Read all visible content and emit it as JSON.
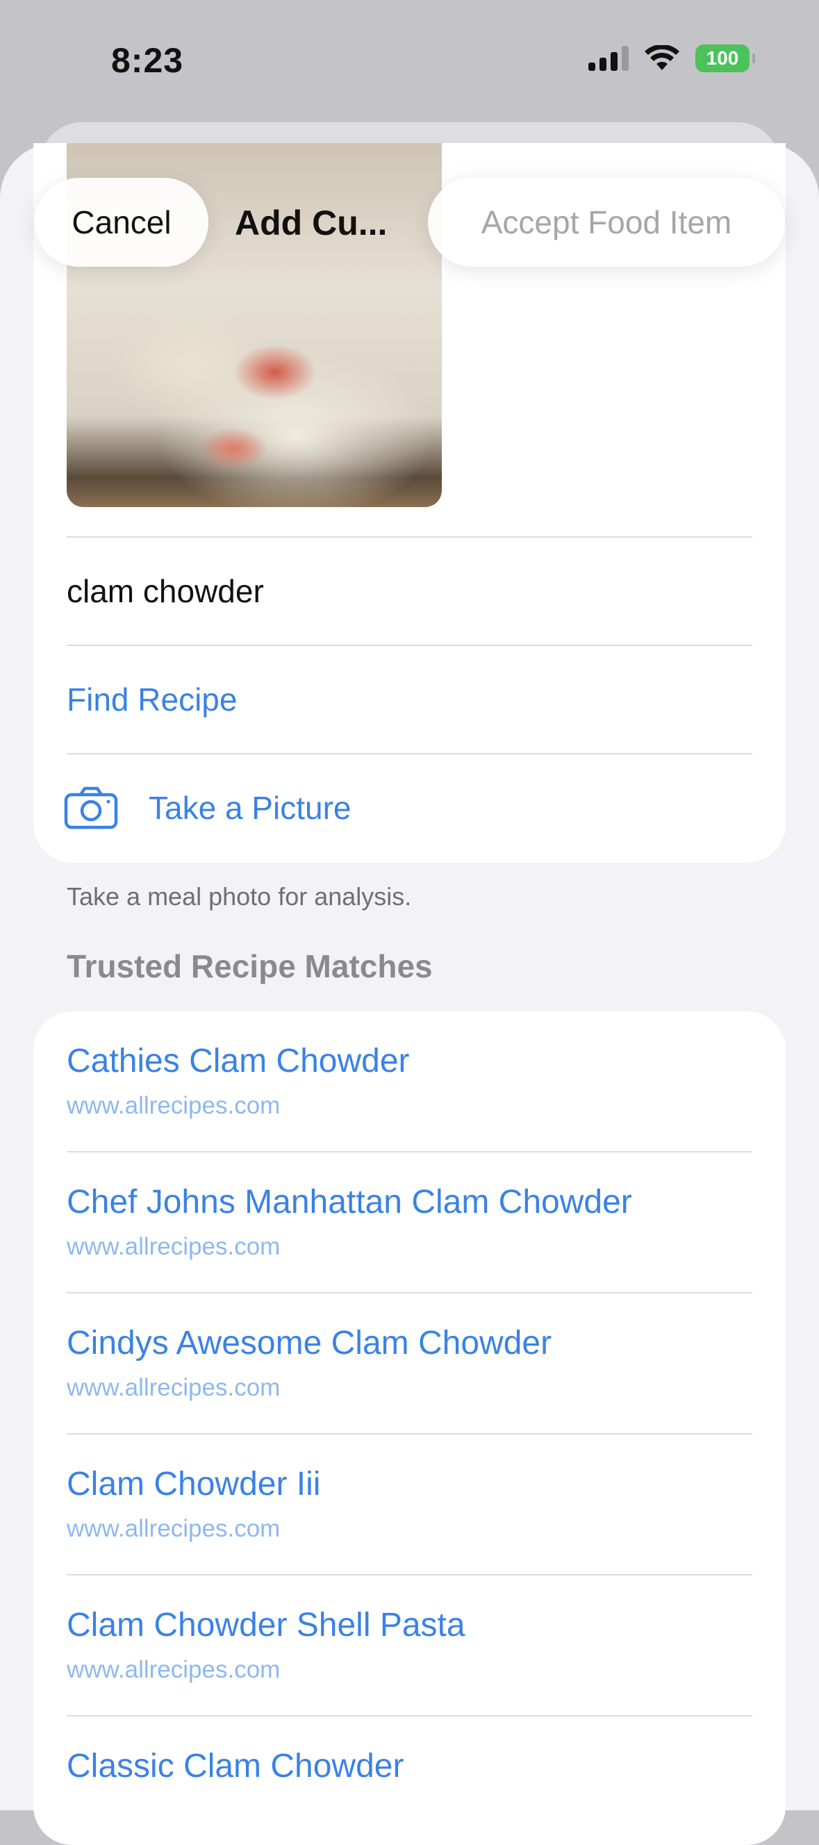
{
  "status": {
    "time": "8:23",
    "battery": "100"
  },
  "nav": {
    "cancel": "Cancel",
    "title": "Add Cu...",
    "accept": "Accept Food Item"
  },
  "form": {
    "food_name": "clam chowder",
    "find_recipe": "Find Recipe",
    "take_picture": "Take a Picture",
    "footer": "Take a meal photo for analysis."
  },
  "recipes": {
    "header": "Trusted Recipe Matches",
    "items": [
      {
        "title": "Cathies Clam Chowder",
        "source": "www.allrecipes.com"
      },
      {
        "title": "Chef Johns Manhattan Clam Chowder",
        "source": "www.allrecipes.com"
      },
      {
        "title": "Cindys Awesome Clam Chowder",
        "source": "www.allrecipes.com"
      },
      {
        "title": "Clam Chowder Iii",
        "source": "www.allrecipes.com"
      },
      {
        "title": "Clam Chowder Shell Pasta",
        "source": "www.allrecipes.com"
      },
      {
        "title": "Classic Clam Chowder",
        "source": ""
      }
    ]
  },
  "colors": {
    "link": "#3a82e4",
    "battery": "#4cc25a"
  }
}
